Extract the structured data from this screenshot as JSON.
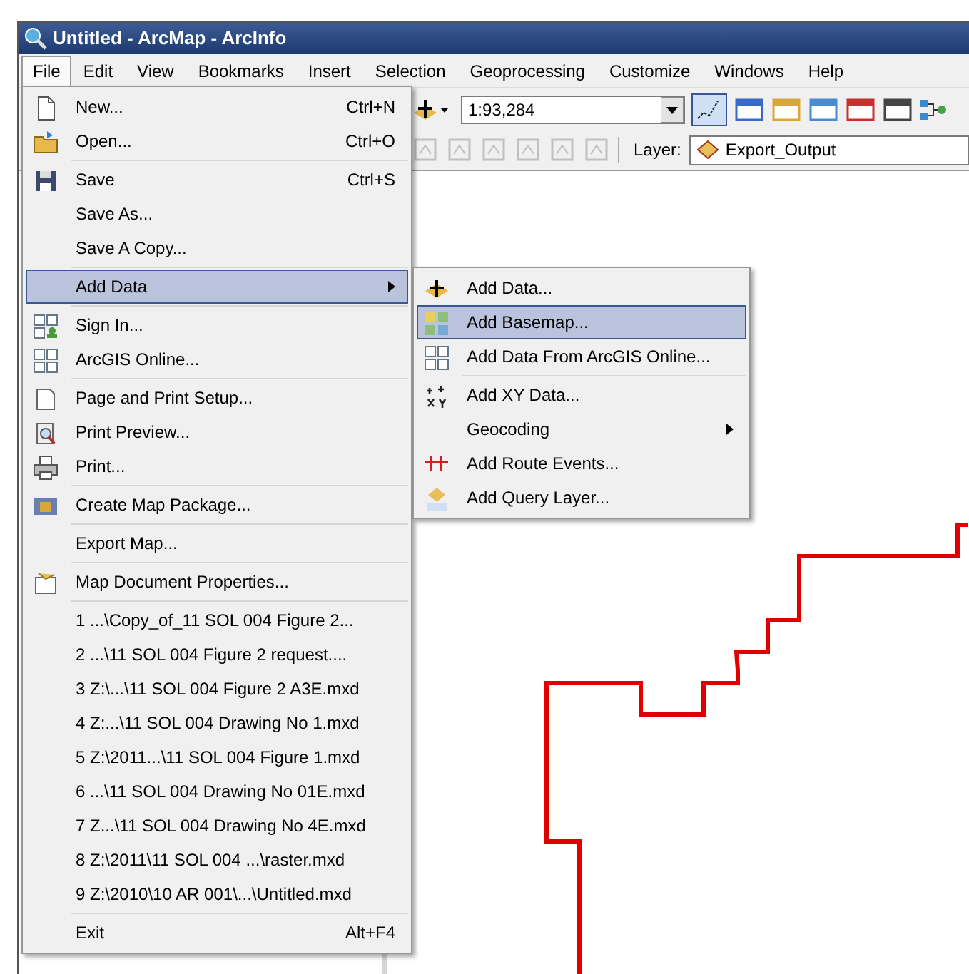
{
  "window": {
    "title": "Untitled - ArcMap - ArcInfo"
  },
  "menubar": [
    {
      "label": "File",
      "selected": true
    },
    {
      "label": "Edit",
      "selected": false
    },
    {
      "label": "View",
      "selected": false
    },
    {
      "label": "Bookmarks",
      "selected": false
    },
    {
      "label": "Insert",
      "selected": false
    },
    {
      "label": "Selection",
      "selected": false
    },
    {
      "label": "Geoprocessing",
      "selected": false
    },
    {
      "label": "Customize",
      "selected": false
    },
    {
      "label": "Windows",
      "selected": false
    },
    {
      "label": "Help",
      "selected": false
    }
  ],
  "toolbar": {
    "scale": "1:93,284",
    "layer_label": "Layer:",
    "layer": "Export_Output"
  },
  "file_menu": [
    {
      "kind": "item",
      "label": "New...",
      "shortcut": "Ctrl+N",
      "selected": false
    },
    {
      "kind": "item",
      "label": "Open...",
      "shortcut": "Ctrl+O",
      "selected": false
    },
    {
      "kind": "separator"
    },
    {
      "kind": "item",
      "label": "Save",
      "shortcut": "Ctrl+S",
      "selected": false
    },
    {
      "kind": "item",
      "label": "Save As...",
      "selected": false
    },
    {
      "kind": "item",
      "label": "Save A Copy...",
      "selected": false
    },
    {
      "kind": "separator"
    },
    {
      "kind": "submenu",
      "label": "Add Data",
      "selected": true
    },
    {
      "kind": "separator"
    },
    {
      "kind": "item",
      "label": "Sign In...",
      "selected": false
    },
    {
      "kind": "item",
      "label": "ArcGIS Online...",
      "selected": false
    },
    {
      "kind": "separator"
    },
    {
      "kind": "item",
      "label": "Page and Print Setup...",
      "selected": false
    },
    {
      "kind": "item",
      "label": "Print Preview...",
      "selected": false
    },
    {
      "kind": "item",
      "label": "Print...",
      "selected": false
    },
    {
      "kind": "separator"
    },
    {
      "kind": "item",
      "label": "Create Map Package...",
      "selected": false
    },
    {
      "kind": "separator"
    },
    {
      "kind": "item",
      "label": "Export Map...",
      "selected": false
    },
    {
      "kind": "separator"
    },
    {
      "kind": "item",
      "label": "Map Document Properties...",
      "selected": false
    },
    {
      "kind": "separator"
    },
    {
      "kind": "item",
      "label": "1 ...\\Copy_of_11 SOL 004 Figure 2...",
      "selected": false
    },
    {
      "kind": "item",
      "label": "2 ...\\11 SOL 004 Figure 2 request....",
      "selected": false
    },
    {
      "kind": "item",
      "label": "3 Z:\\...\\11 SOL 004 Figure 2 A3E.mxd",
      "selected": false
    },
    {
      "kind": "item",
      "label": "4 Z:...\\11 SOL 004 Drawing No 1.mxd",
      "selected": false
    },
    {
      "kind": "item",
      "label": "5 Z:\\2011...\\11 SOL 004 Figure 1.mxd",
      "selected": false
    },
    {
      "kind": "item",
      "label": "6 ...\\11 SOL 004 Drawing No 01E.mxd",
      "selected": false
    },
    {
      "kind": "item",
      "label": "7 Z...\\11 SOL 004 Drawing No 4E.mxd",
      "selected": false
    },
    {
      "kind": "item",
      "label": "8 Z:\\2011\\11 SOL 004 ...\\raster.mxd",
      "selected": false
    },
    {
      "kind": "item",
      "label": "9 Z:\\2010\\10 AR 001\\...\\Untitled.mxd",
      "selected": false
    },
    {
      "kind": "separator"
    },
    {
      "kind": "item",
      "label": "Exit",
      "shortcut": "Alt+F4",
      "selected": false
    }
  ],
  "add_data_menu": [
    {
      "kind": "item",
      "label": "Add Data...",
      "selected": false
    },
    {
      "kind": "item",
      "label": "Add Basemap...",
      "selected": true
    },
    {
      "kind": "item",
      "label": "Add Data From ArcGIS Online...",
      "selected": false
    },
    {
      "kind": "separator"
    },
    {
      "kind": "item",
      "label": "Add XY Data...",
      "selected": false
    },
    {
      "kind": "submenu",
      "label": "Geocoding",
      "selected": false
    },
    {
      "kind": "item",
      "label": "Add Route Events...",
      "selected": false
    },
    {
      "kind": "item",
      "label": "Add Query Layer...",
      "selected": false
    }
  ]
}
